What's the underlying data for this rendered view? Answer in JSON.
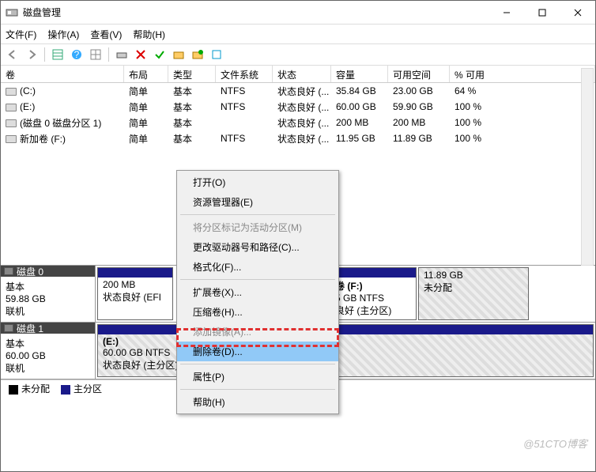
{
  "window": {
    "title": "磁盘管理"
  },
  "winbtns": {
    "min": "minimize",
    "max": "maximize",
    "close": "close"
  },
  "menubar": [
    "文件(F)",
    "操作(A)",
    "查看(V)",
    "帮助(H)"
  ],
  "columns": [
    "卷",
    "布局",
    "类型",
    "文件系统",
    "状态",
    "容量",
    "可用空间",
    "% 可用"
  ],
  "volumes": [
    {
      "name": "(C:)",
      "layout": "简单",
      "type": "基本",
      "fs": "NTFS",
      "status": "状态良好 (...",
      "capacity": "35.84 GB",
      "free": "23.00 GB",
      "pct": "64 %"
    },
    {
      "name": "(E:)",
      "layout": "简单",
      "type": "基本",
      "fs": "NTFS",
      "status": "状态良好 (...",
      "capacity": "60.00 GB",
      "free": "59.90 GB",
      "pct": "100 %"
    },
    {
      "name": "(磁盘 0 磁盘分区 1)",
      "layout": "简单",
      "type": "基本",
      "fs": "",
      "status": "状态良好 (...",
      "capacity": "200 MB",
      "free": "200 MB",
      "pct": "100 %"
    },
    {
      "name": "新加卷 (F:)",
      "layout": "简单",
      "type": "基本",
      "fs": "NTFS",
      "status": "状态良好 (...",
      "capacity": "11.95 GB",
      "free": "11.89 GB",
      "pct": "100 %"
    }
  ],
  "disks": {
    "d0": {
      "title": "磁盘 0",
      "type": "基本",
      "size": "59.88 GB",
      "status": "联机",
      "p1": {
        "size": "200 MB",
        "status": "状态良好 (EFI"
      },
      "p3": {
        "label": "卷  (F:)",
        "fs": "5 GB NTFS",
        "status": "良好 (主分区)"
      },
      "p4": {
        "size": "11.89 GB",
        "status": "未分配"
      }
    },
    "d1": {
      "title": "磁盘 1",
      "type": "基本",
      "size": "60.00 GB",
      "status": "联机",
      "p1": {
        "label": "(E:)",
        "fs": "60.00 GB NTFS",
        "status": "状态良好 (主分区)"
      }
    }
  },
  "legend": {
    "unalloc": "未分配",
    "primary": "主分区"
  },
  "context_menu": [
    {
      "label": "打开(O)",
      "enabled": true
    },
    {
      "label": "资源管理器(E)",
      "enabled": true
    },
    {
      "sep": true
    },
    {
      "label": "将分区标记为活动分区(M)",
      "enabled": false
    },
    {
      "label": "更改驱动器号和路径(C)...",
      "enabled": true
    },
    {
      "label": "格式化(F)...",
      "enabled": true
    },
    {
      "sep": true
    },
    {
      "label": "扩展卷(X)...",
      "enabled": true
    },
    {
      "label": "压缩卷(H)...",
      "enabled": true
    },
    {
      "label": "添加镜像(A)...",
      "enabled": false
    },
    {
      "label": "删除卷(D)...",
      "enabled": true,
      "highlight": true
    },
    {
      "sep": true
    },
    {
      "label": "属性(P)",
      "enabled": true
    },
    {
      "sep": true
    },
    {
      "label": "帮助(H)",
      "enabled": true
    }
  ],
  "watermark": "@51CTO博客"
}
